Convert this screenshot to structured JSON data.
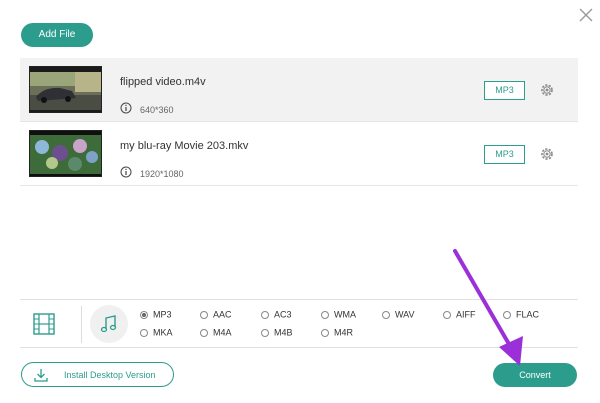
{
  "toolbar": {
    "add_file_label": "Add File"
  },
  "files": [
    {
      "name": "flipped video.m4v",
      "resolution": "640*360",
      "format": "MP3",
      "selected": true
    },
    {
      "name": "my blu-ray Movie 203.mkv",
      "resolution": "1920*1080",
      "format": "MP3",
      "selected": false
    }
  ],
  "audio_formats": {
    "selected": "MP3",
    "options": [
      "MP3",
      "AAC",
      "AC3",
      "WMA",
      "WAV",
      "AIFF",
      "FLAC",
      "MKA",
      "M4A",
      "M4B",
      "M4R"
    ]
  },
  "footer": {
    "install_label": "Install Desktop Version",
    "convert_label": "Convert"
  },
  "colors": {
    "accent": "#2c9d8d",
    "annotation_arrow": "#9b30d9",
    "selected_row": "#f2f2f2"
  },
  "icons": {
    "close": "close-icon",
    "info": "info-icon",
    "settings": "gear-icon",
    "video_tab": "film-icon",
    "audio_tab": "music-note-icon",
    "install": "download-icon"
  }
}
